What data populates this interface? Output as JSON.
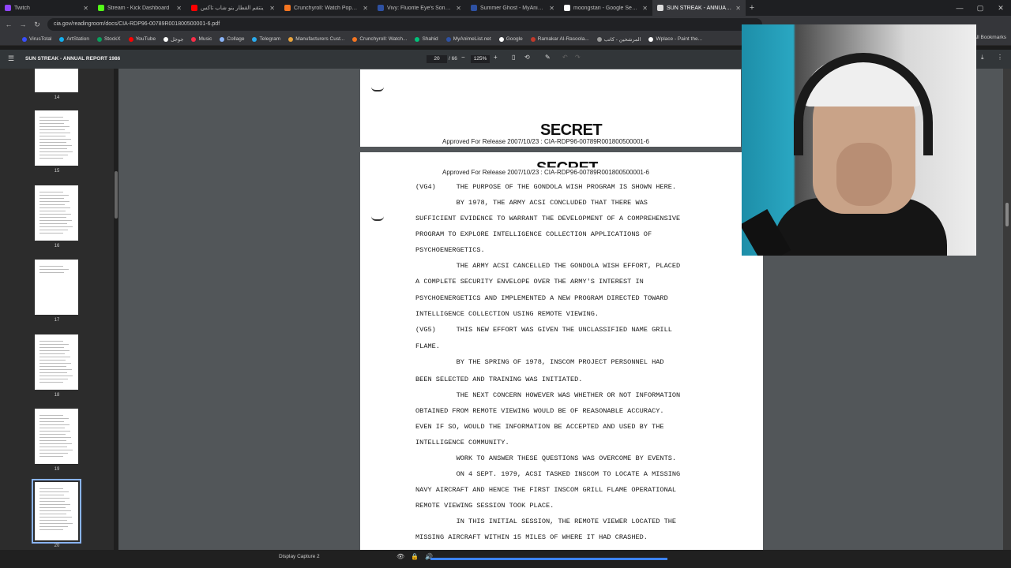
{
  "tabs": [
    {
      "label": "Twitch",
      "color": "#9146ff",
      "active": false
    },
    {
      "label": "Stream - Kick Dashboard",
      "color": "#53fc18",
      "active": false
    },
    {
      "label": "ينتقم القطار بنو شاب تاكس",
      "color": "#ff0000",
      "active": false
    },
    {
      "label": "Crunchyroll: Watch Popular Ani",
      "color": "#f47521",
      "active": false
    },
    {
      "label": "Vivy: Fluorite Eye's Song (Vivy",
      "color": "#2e51a2",
      "active": false
    },
    {
      "label": "Summer Ghost - MyAnimeList.n",
      "color": "#2e51a2",
      "active": false
    },
    {
      "label": "moongstari - Google Search",
      "color": "#ffffff",
      "active": false
    },
    {
      "label": "SUN STREAK - ANNUAL REPORT",
      "color": "#dddddd",
      "active": true
    }
  ],
  "url": "cia.gov/readingroom/docs/CIA-RDP96-00789R001800500001-6.pdf",
  "bookmarks": [
    {
      "label": "VirusTotal",
      "color": "#394eff"
    },
    {
      "label": "ArtStation",
      "color": "#13aff0"
    },
    {
      "label": "StockX",
      "color": "#08a05c"
    },
    {
      "label": "YouTube",
      "color": "#ff0000"
    },
    {
      "label": "جوجل",
      "color": "#ffffff"
    },
    {
      "label": "Music",
      "color": "#fa2d48"
    },
    {
      "label": "Collage",
      "color": "#8ab4f8"
    },
    {
      "label": "Telegram",
      "color": "#2aabee"
    },
    {
      "label": "Manufacturers Cust...",
      "color": "#e8a33d"
    },
    {
      "label": "Crunchyroll: Watch...",
      "color": "#f47521"
    },
    {
      "label": "Shahid",
      "color": "#00c27a"
    },
    {
      "label": "MyAnimeList.net",
      "color": "#2e51a2"
    },
    {
      "label": "Google",
      "color": "#ffffff"
    },
    {
      "label": "Ramakar Al-Rasoola...",
      "color": "#c0392b"
    },
    {
      "label": "المرشحين - كاتب",
      "color": "#999999"
    },
    {
      "label": "Wplace - Paint the...",
      "color": "#ffffff"
    }
  ],
  "all_bookmarks": "All Bookmarks",
  "pdf": {
    "title": "SUN STREAK - ANNUAL REPORT 1986",
    "page_current": "20",
    "page_total": "/ 66",
    "zoom": "125%"
  },
  "thumbnails": [
    {
      "num": "14"
    },
    {
      "num": "15"
    },
    {
      "num": "16"
    },
    {
      "num": "17"
    },
    {
      "num": "18"
    },
    {
      "num": "19"
    },
    {
      "num": "20"
    }
  ],
  "page_top": {
    "approved": "Approved For Release 2007/10/23 : CIA-RDP96-00789R001800500001-6",
    "stamp": "SECRET"
  },
  "page_main": {
    "approved": "Approved For Release 2007/10/23 : CIA-RDP96-00789R001800500001-6",
    "stamp": "SECRET",
    "lines": [
      "(VG4)     THE PURPOSE OF THE GONDOLA WISH PROGRAM IS SHOWN HERE.",
      "          BY 1978, THE ARMY ACSI CONCLUDED THAT THERE WAS",
      "SUFFICIENT EVIDENCE TO WARRANT THE DEVELOPMENT OF A COMPREHENSIVE",
      "PROGRAM TO EXPLORE INTELLIGENCE COLLECTION APPLICATIONS OF",
      "PSYCHOENERGETICS.",
      "          THE ARMY ACSI CANCELLED THE GONDOLA WISH EFFORT, PLACED",
      "A COMPLETE SECURITY ENVELOPE OVER THE ARMY'S INTEREST IN",
      "PSYCHOENERGETICS AND IMPLEMENTED A NEW PROGRAM DIRECTED TOWARD",
      "INTELLIGENCE COLLECTION USING REMOTE VIEWING.",
      "(VG5)     THIS NEW EFFORT WAS GIVEN THE UNCLASSIFIED NAME GRILL",
      "FLAME.",
      "          BY THE SPRING OF 1978, INSCOM PROJECT PERSONNEL HAD",
      "BEEN SELECTED AND TRAINING WAS INITIATED.",
      "          THE NEXT CONCERN HOWEVER WAS WHETHER OR NOT INFORMATION",
      "OBTAINED FROM REMOTE VIEWING WOULD BE OF REASONABLE ACCURACY.",
      "EVEN IF SO, WOULD THE INFORMATION BE ACCEPTED AND USED BY THE",
      "INTELLIGENCE COMMUNITY.",
      "          WORK TO ANSWER THESE QUESTIONS WAS OVERCOME BY EVENTS.",
      "          ON 4 SEPT. 1979, ACSI TASKED INSCOM TO LOCATE A MISSING",
      "NAVY AIRCRAFT AND HENCE THE FIRST INSCOM GRILL FLAME OPERATIONAL",
      "REMOTE VIEWING SESSION TOOK PLACE.",
      "          IN THIS INITIAL SESSION, THE REMOTE VIEWER LOCATED THE",
      "MISSING AIRCRAFT WITHIN 15 MILES OF WHERE IT HAD CRASHED."
    ]
  },
  "taskbar": {
    "task": "Display Capture 2"
  }
}
